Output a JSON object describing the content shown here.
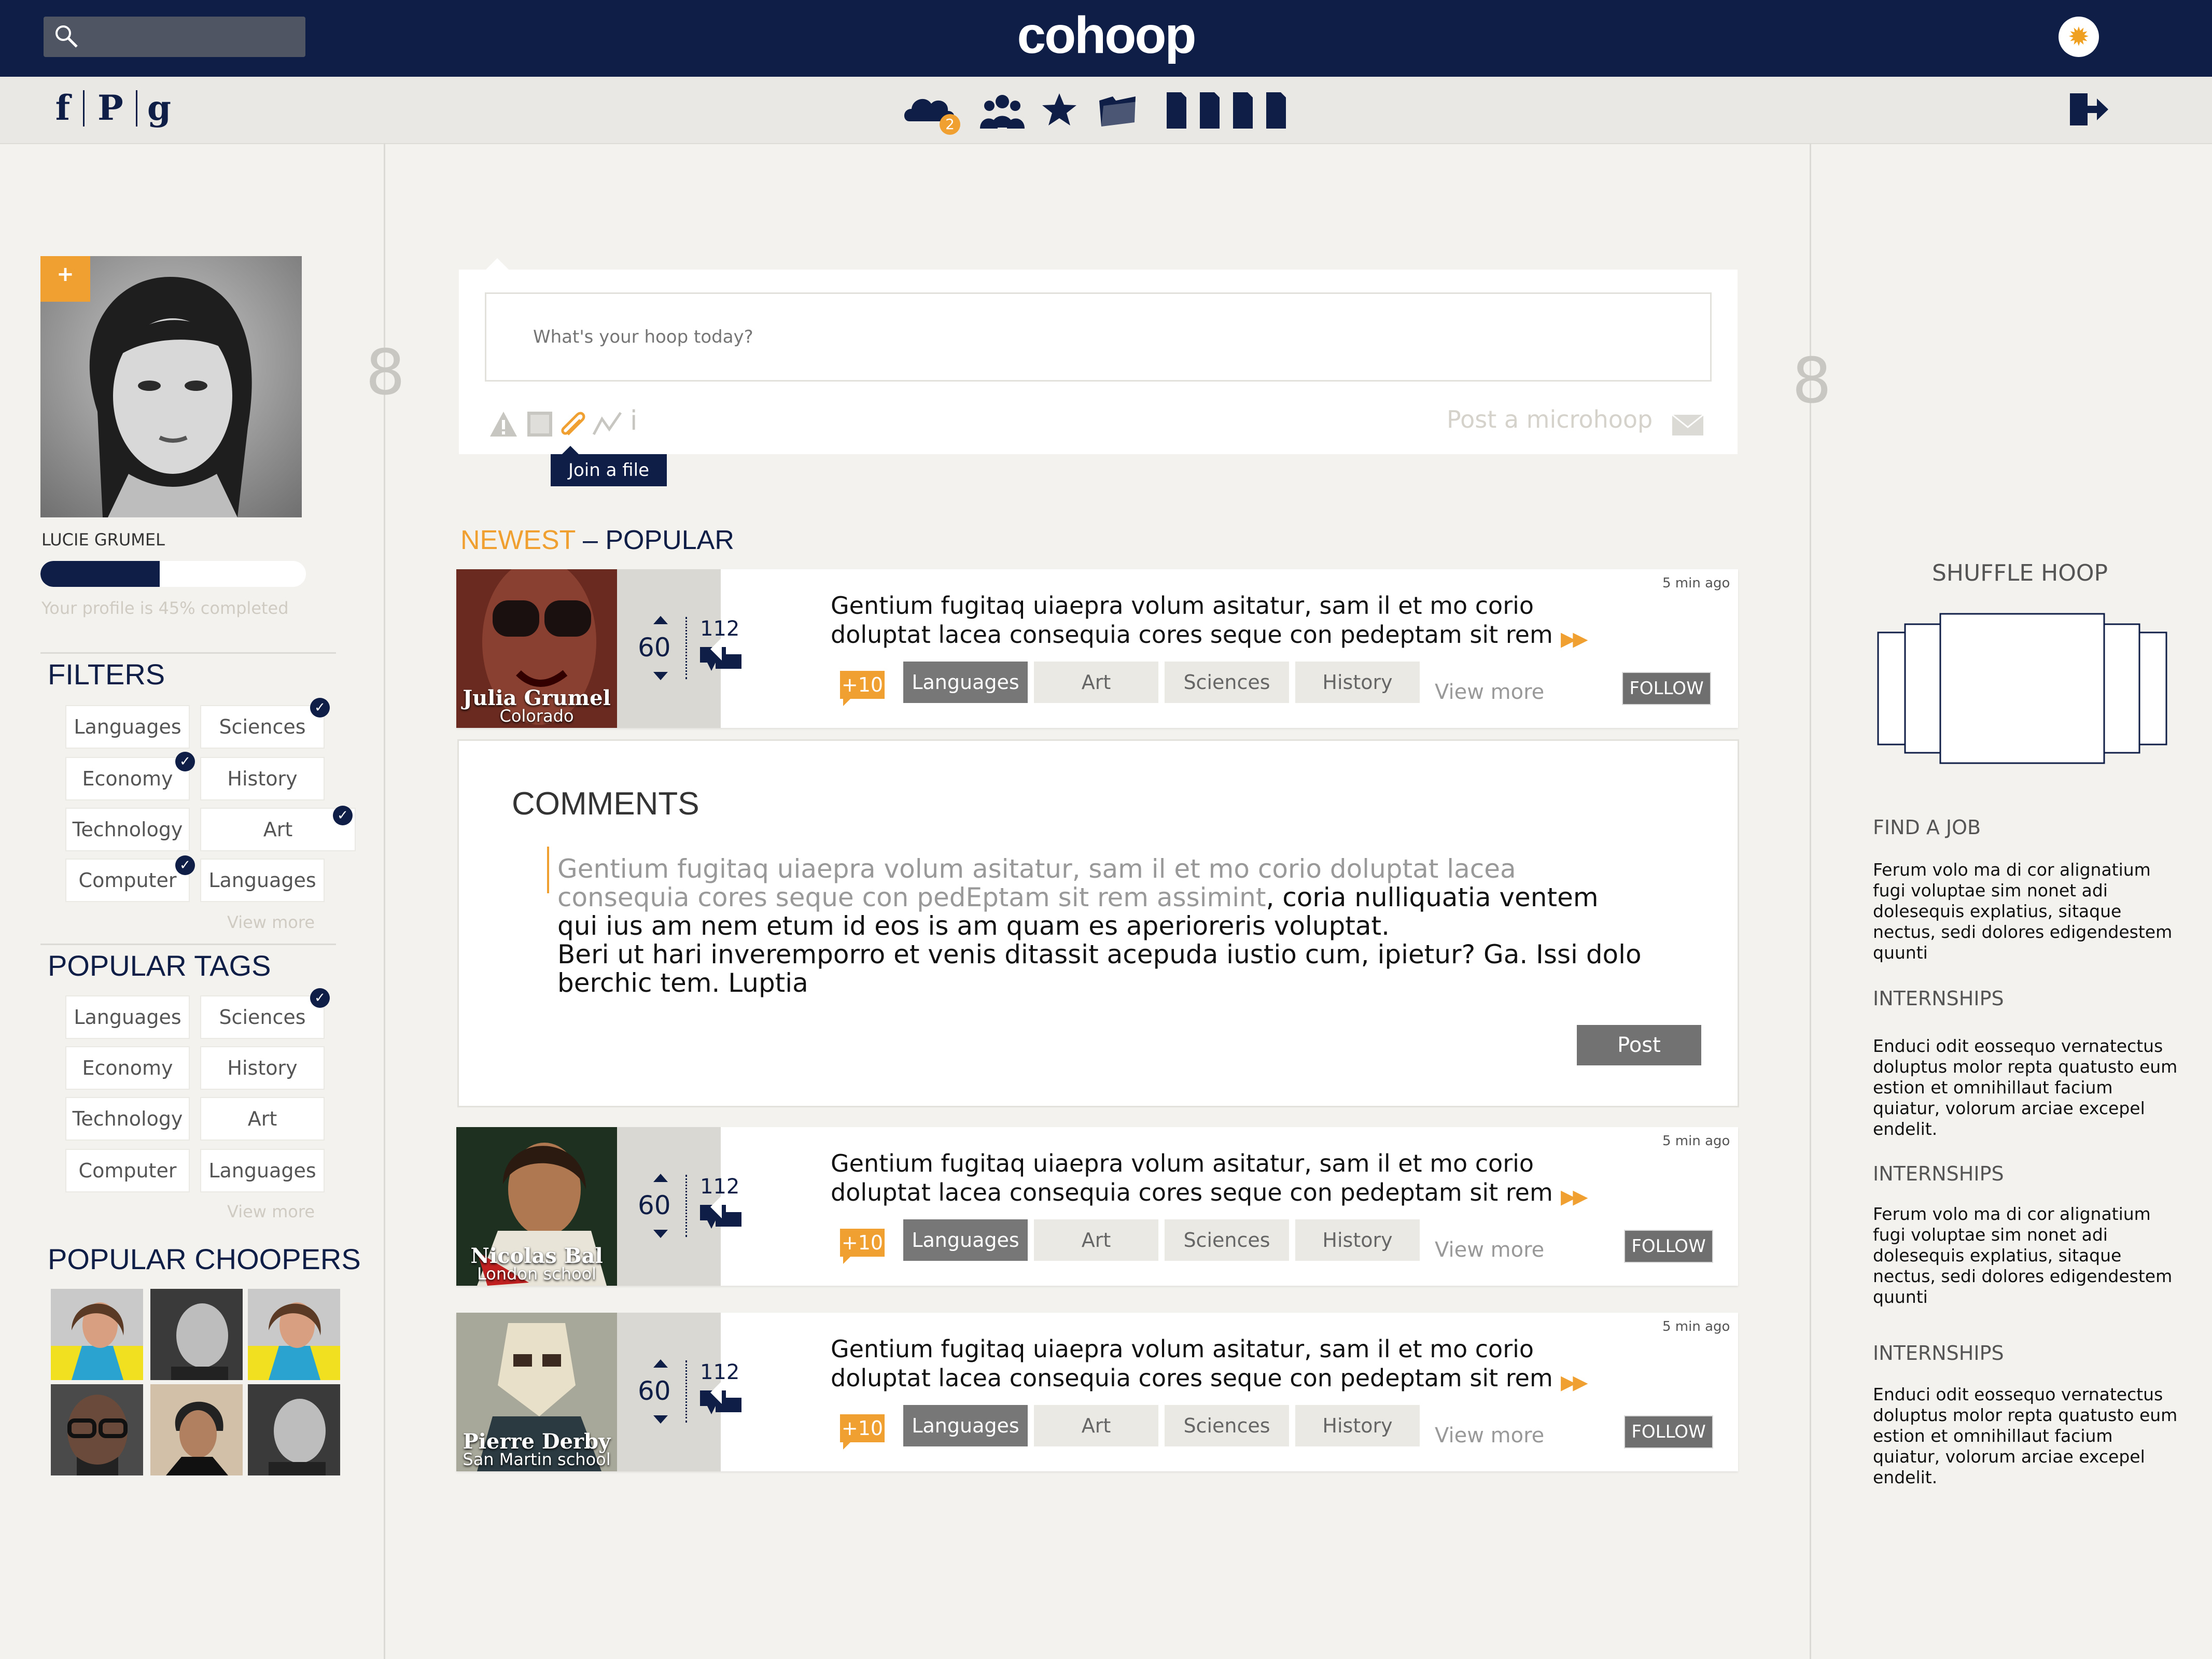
{
  "topbar": {
    "logo": "cohoop",
    "search_placeholder": "",
    "settings_icon": "gear-icon"
  },
  "subbar": {
    "social": [
      "f",
      "P",
      "g"
    ],
    "notification_count": "2"
  },
  "profile": {
    "name": "LUCIE GRUMEL",
    "completion_text": "Your profile is 45% completed",
    "completion": 0.45
  },
  "filters": {
    "title": "FILTERS",
    "items": [
      "Languages",
      "Sciences",
      "Economy",
      "History",
      "Technology",
      "Art",
      "Computer",
      "Languages"
    ],
    "view_more": "View more"
  },
  "popular_tags": {
    "title": "POPULAR TAGS",
    "items": [
      "Languages",
      "Sciences",
      "Economy",
      "History",
      "Technology",
      "Art",
      "Computer",
      "Languages"
    ],
    "view_more": "View more"
  },
  "popular_choopers": {
    "title": "POPULAR CHOOPERS"
  },
  "composer": {
    "placeholder": "What's your hoop today?",
    "post_label": "Post a microhoop",
    "tooltip": "Join a file"
  },
  "feed_tabs": {
    "newest": "NEWEST",
    "sep": " – ",
    "popular": "POPULAR"
  },
  "hoops": [
    {
      "author": "Julia Grumel",
      "location": "Colorado",
      "time": "5 min ago",
      "score": "60",
      "comments": "112",
      "text": "Gentium fugitaq uiaepra volum asitatur, sam il et mo corio doluptat lacea consequia cores seque con pedeptam sit rem",
      "bonus": "+10",
      "tags": [
        "Languages",
        "Art",
        "Sciences",
        "History"
      ],
      "view_more": "View more",
      "follow": "FOLLOW"
    },
    {
      "author": "Nicolas Bal",
      "location": "London school",
      "time": "5 min ago",
      "score": "60",
      "comments": "112",
      "text": "Gentium fugitaq uiaepra volum asitatur, sam il et mo corio doluptat lacea consequia cores seque con pedeptam sit rem",
      "bonus": "+10",
      "tags": [
        "Languages",
        "Art",
        "Sciences",
        "History"
      ],
      "view_more": "View more",
      "follow": "FOLLOW"
    },
    {
      "author": "Pierre Derby",
      "location": "San Martin school",
      "time": "5 min ago",
      "score": "60",
      "comments": "112",
      "text": "Gentium fugitaq uiaepra volum asitatur, sam il et mo corio doluptat lacea consequia cores seque con pedeptam sit rem",
      "bonus": "+10",
      "tags": [
        "Languages",
        "Art",
        "Sciences",
        "History"
      ],
      "view_more": "View more",
      "follow": "FOLLOW"
    }
  ],
  "comments": {
    "title": "COMMENTS",
    "quoted": "Gentium fugitaq uiaepra volum asitatur, sam il et mo corio doluptat lacea consequia cores seque con pedEptam sit rem assimint",
    "reply": ", coria nulliquatia ventem qui ius am nem etum id eos is am quam es aperioreris voluptat.",
    "reply2": "Beri ut hari inveremporro et venis ditassit acepuda iustio cum, ipietur? Ga. Issi dolo berchic tem. Luptia",
    "post_button": "Post"
  },
  "right": {
    "shuffle_title": "SHUFFLE HOOP",
    "sections": [
      {
        "title": "FIND A JOB",
        "text": "Ferum volo ma di cor alignatium fugi voluptae sim nonet adi dolesequis explatius, sitaque nectus, sedi dolores edigendestem quunti"
      },
      {
        "title": "INTERNSHIPS",
        "text": "Enduci odit eossequo vernatectus doluptus molor repta quatusto eum estion et omnihillaut facium quiatur, volorum arciae excepel endelit."
      },
      {
        "title": "INTERNSHIPS",
        "text": "Ferum volo ma di cor alignatium fugi voluptae sim nonet adi dolesequis explatius, sitaque nectus, sedi dolores edigendestem quunti"
      },
      {
        "title": "INTERNSHIPS",
        "text": "Enduci odit eossequo vernatectus doluptus molor repta quatusto eum estion et omnihillaut facium quiatur, volorum arciae excepel endelit."
      }
    ]
  },
  "colors": {
    "navy": "#0f1e46",
    "accent": "#f0a030",
    "background": "#f3f2ee"
  }
}
